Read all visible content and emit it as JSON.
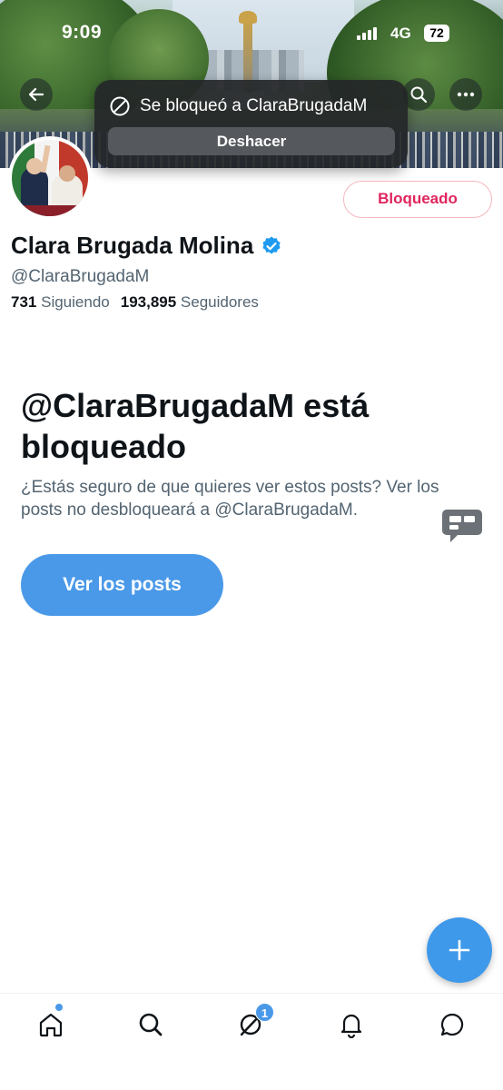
{
  "status_bar": {
    "time": "9:09",
    "network": "4G",
    "battery": "72"
  },
  "toast": {
    "message": "Se bloqueó a ClaraBrugadaM",
    "undo_label": "Deshacer"
  },
  "profile": {
    "name": "Clara Brugada Molina",
    "handle": "@ClaraBrugadaM",
    "following_count": "731",
    "following_label": "Siguiendo",
    "followers_count": "193,895",
    "followers_label": "Seguidores",
    "blocked_button_label": "Bloqueado",
    "verified_color": "#1d9bf0"
  },
  "blocked_notice": {
    "title": "@ClaraBrugadaM está bloqueado",
    "description": "¿Estás seguro de que quieres ver estos posts? Ver los posts no desbloqueará a @ClaraBrugadaM.",
    "view_posts_label": "Ver los posts"
  },
  "tabbar": {
    "items": [
      {
        "name": "home",
        "icon": "home-icon",
        "has_dot": true
      },
      {
        "name": "search",
        "icon": "search-icon"
      },
      {
        "name": "grok",
        "icon": "grok-icon",
        "badge": "1"
      },
      {
        "name": "notifications",
        "icon": "bell-icon"
      },
      {
        "name": "messages",
        "icon": "message-icon"
      }
    ]
  },
  "colors": {
    "accent": "#4a99e9",
    "blocked_red": "#e0245e"
  }
}
